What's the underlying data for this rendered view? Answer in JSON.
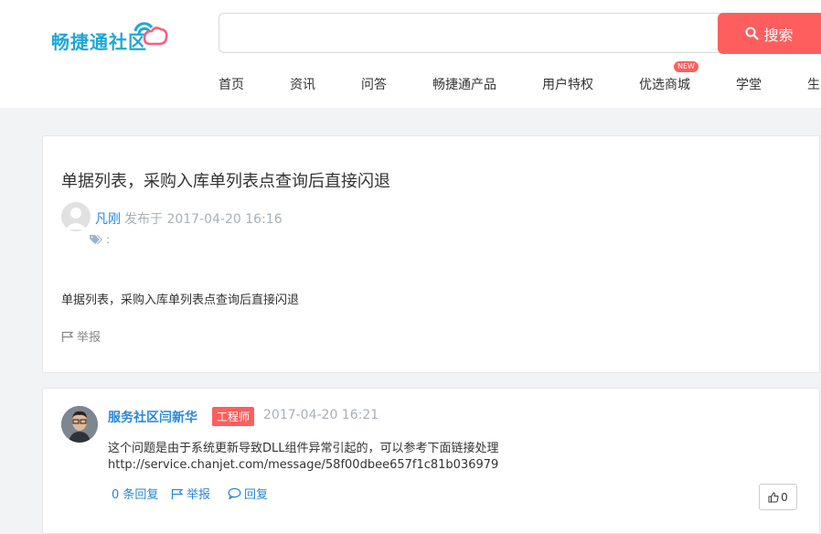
{
  "header": {
    "logo_text": "畅捷通社区",
    "search": {
      "value": "",
      "placeholder": ""
    },
    "search_button": "搜索",
    "nav": [
      {
        "label": "首页"
      },
      {
        "label": "资讯"
      },
      {
        "label": "问答"
      },
      {
        "label": "畅捷通产品"
      },
      {
        "label": "用户特权"
      },
      {
        "label": "优选商城",
        "badge": "NEW"
      },
      {
        "label": "学堂"
      },
      {
        "label": "生"
      }
    ]
  },
  "question": {
    "title": "单据列表，采购入库单列表点查询后直接闪退",
    "author": "凡刚",
    "meta": "发布于 2017-04-20 16:16",
    "tags_label": ":",
    "body": "单据列表，采购入库单列表点查询后直接闪退",
    "report": "举报"
  },
  "answer": {
    "author": "服务社区闫新华",
    "badge": "工程师",
    "time": "2017-04-20 16:21",
    "text": "这个问题是由于系统更新导致DLL组件异常引起的，可以参考下面链接处理",
    "link": "http://service.chanjet.com/message/58f00dbee657f1c81b036979",
    "replies": "0 条回复",
    "report": "举报",
    "reply": "回复",
    "likes": "0"
  },
  "colors": {
    "accent_red": "#fe5e5e",
    "link_blue": "#2a86d9",
    "logo_blue": "#1ea7d6",
    "page_bg": "#f2f3f5"
  },
  "icons": [
    "search-icon",
    "logo-signal-icon",
    "user-icon",
    "tag-icon",
    "flag-icon",
    "comment-icon",
    "thumbs-up-icon"
  ]
}
